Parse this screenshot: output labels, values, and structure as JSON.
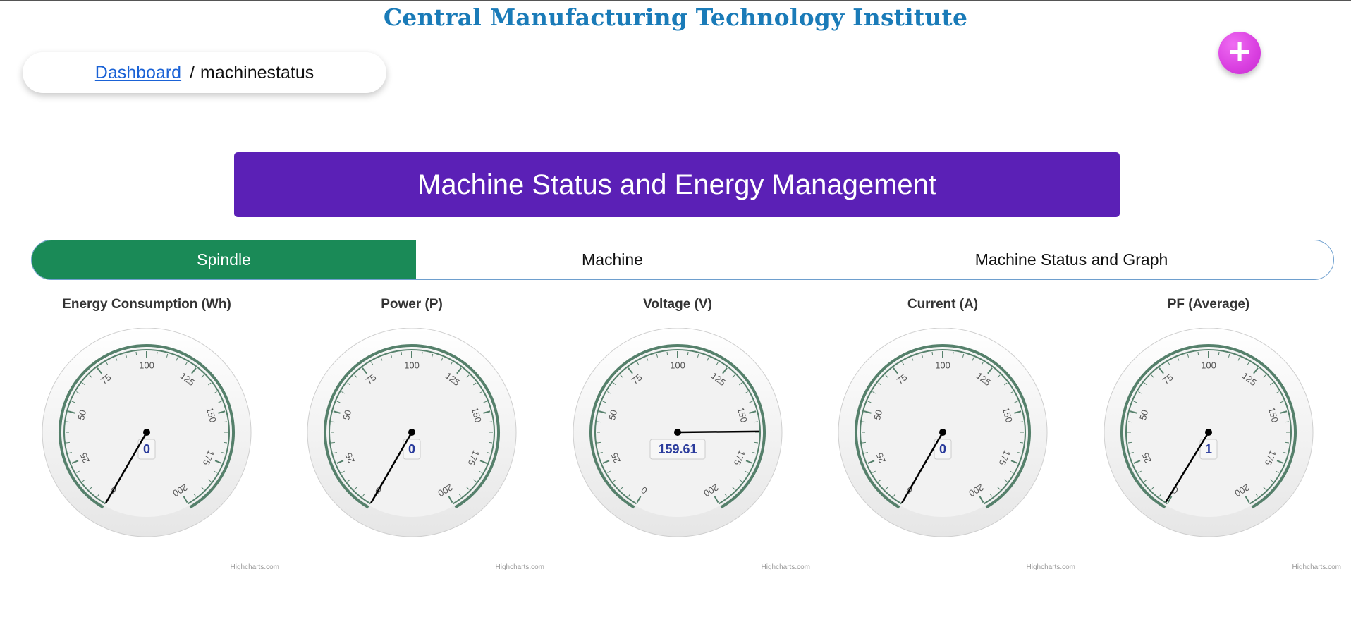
{
  "header": {
    "title": "Central Manufacturing Technology Institute"
  },
  "breadcrumb": {
    "link_label": "Dashboard",
    "separator": "/",
    "current": "machinestatus"
  },
  "fab": {
    "icon": "plus-icon",
    "label": "+"
  },
  "banner": {
    "title": "Machine Status and Energy Management"
  },
  "tabs": [
    {
      "label": "Spindle",
      "active": true
    },
    {
      "label": "Machine",
      "active": false
    },
    {
      "label": "Machine Status and Graph",
      "active": false
    }
  ],
  "colors": {
    "title": "#1a7bb8",
    "banner": "#5b20b6",
    "active_tab": "#1a8a57",
    "fab": "#d93fe0",
    "gauge_band": "#55806b",
    "value_text": "#2a3b9c"
  },
  "chart_data": [
    {
      "type": "gauge",
      "title": "Energy Consumption (Wh)",
      "min": 0,
      "max": 200,
      "ticks": [
        0,
        25,
        50,
        75,
        100,
        125,
        150,
        175,
        200
      ],
      "value": 0,
      "value_label": "0",
      "credits": "Highcharts.com"
    },
    {
      "type": "gauge",
      "title": "Power (P)",
      "min": 0,
      "max": 200,
      "ticks": [
        0,
        25,
        50,
        75,
        100,
        125,
        150,
        175,
        200
      ],
      "value": 0,
      "value_label": "0",
      "credits": "Highcharts.com"
    },
    {
      "type": "gauge",
      "title": "Voltage (V)",
      "min": 0,
      "max": 200,
      "ticks": [
        0,
        25,
        50,
        75,
        100,
        125,
        150,
        175,
        200
      ],
      "value": 159.61,
      "value_label": "159.61",
      "credits": "Highcharts.com"
    },
    {
      "type": "gauge",
      "title": "Current (A)",
      "min": 0,
      "max": 200,
      "ticks": [
        0,
        25,
        50,
        75,
        100,
        125,
        150,
        175,
        200
      ],
      "value": 0,
      "value_label": "0",
      "credits": "Highcharts.com"
    },
    {
      "type": "gauge",
      "title": "PF (Average)",
      "min": 0,
      "max": 200,
      "ticks": [
        0,
        25,
        50,
        75,
        100,
        125,
        150,
        175,
        200
      ],
      "value": 1,
      "value_label": "1",
      "credits": "Highcharts.com"
    }
  ]
}
